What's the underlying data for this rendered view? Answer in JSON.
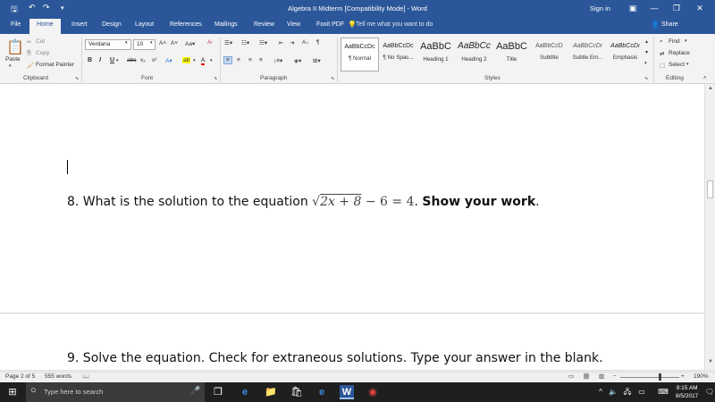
{
  "titlebar": {
    "title": "Algebra II Midterm [Compatibility Mode] - Word",
    "sign_in": "Sign in"
  },
  "tabs": [
    "File",
    "Home",
    "Insert",
    "Design",
    "Layout",
    "References",
    "Mailings",
    "Review",
    "View",
    "Foxit PDF"
  ],
  "tell_me": "Tell me what you want to do",
  "share": "Share",
  "clipboard": {
    "paste": "Paste",
    "cut": "Cut",
    "copy": "Copy",
    "format_painter": "Format Painter",
    "label": "Clipboard"
  },
  "font": {
    "name": "Verdana",
    "size": "10",
    "label": "Font"
  },
  "paragraph_label": "Paragraph",
  "styles": {
    "label": "Styles",
    "items": [
      {
        "sample": "AaBbCcDc",
        "name": "¶ Normal"
      },
      {
        "sample": "AaBbCcDc",
        "name": "¶ No Spac..."
      },
      {
        "sample": "AaBbC",
        "name": "Heading 1"
      },
      {
        "sample": "AaBbCc",
        "name": "Heading 2"
      },
      {
        "sample": "AaBbC",
        "name": "Title"
      },
      {
        "sample": "AaBbCcD",
        "name": "Subtitle"
      },
      {
        "sample": "AaBbCcDı",
        "name": "Subtle Em..."
      },
      {
        "sample": "AaBbCcDı",
        "name": "Emphasis"
      }
    ]
  },
  "editing": {
    "find": "Find",
    "replace": "Replace",
    "select": "Select",
    "label": "Editing"
  },
  "document": {
    "q8_prefix": "8. What is the solution to the equation ",
    "q8_radicand": "2x + 8",
    "q8_rest": " − 6 = 4",
    "q8_period": ". ",
    "q8_bold": "Show your work",
    "q8_end": ".",
    "q9_partial": "9. Solve the equation. Check for extraneous solutions. Type your answer in the blank."
  },
  "status": {
    "page": "Page 2 of 5",
    "words": "555 words",
    "zoom": "190%"
  },
  "taskbar": {
    "search_placeholder": "Type here to search",
    "time": "9:15 AM",
    "date": "8/5/2017"
  }
}
